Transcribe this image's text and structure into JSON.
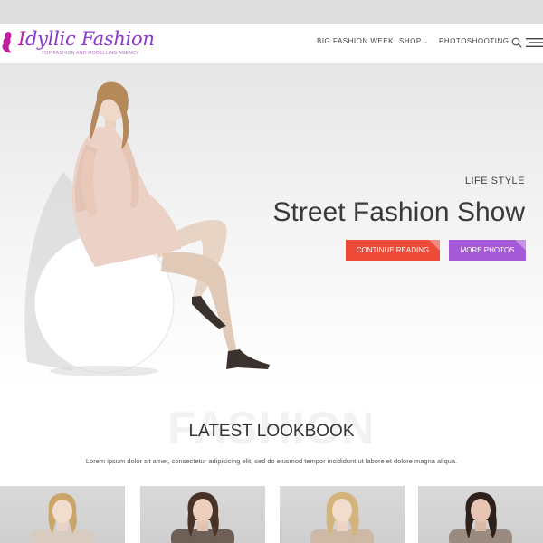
{
  "brand": {
    "name": "Idyllic Fashion",
    "name_first_letter": "I",
    "name_rest": "dyllic Fashion",
    "tagline": "TOP FASHION AND MODELLING AGENCY",
    "colors": {
      "primary": "#8a3ad0",
      "accent": "#c21fa0"
    }
  },
  "nav": {
    "items": [
      {
        "label": "BIG FASHION WEEK",
        "has_dropdown": false
      },
      {
        "label": "SHOP",
        "has_dropdown": true
      },
      {
        "label": "PHOTOSHOOTING",
        "has_dropdown": false
      }
    ],
    "dropdown_glyph": "⌄",
    "icons": [
      "search-icon",
      "hamburger-menu-icon"
    ]
  },
  "hero": {
    "kicker": "LIFE STYLE",
    "title": "Street Fashion Show",
    "buttons": [
      {
        "label": "CONTINUE READING",
        "color": "#ee4a38"
      },
      {
        "label": "MORE PHOTOS",
        "color": "#a45ad6"
      }
    ]
  },
  "lookbook": {
    "background_word": "FASHION",
    "title": "LATEST LOOKBOOK",
    "description": "Lorem ipsum dolor sit amet, consectetur adipisicing elit, sed do eiusmod tempor incididunt ut labore et dolore magna aliqua.",
    "cards": [
      {
        "hair": "#c9a56a",
        "top": "#d8cbbf"
      },
      {
        "hair": "#4a3226",
        "top": "#6e5f57"
      },
      {
        "hair": "#d2b47c",
        "top": "#cdb9a6"
      },
      {
        "hair": "#2e211c",
        "top": "#9a8a80"
      }
    ]
  }
}
